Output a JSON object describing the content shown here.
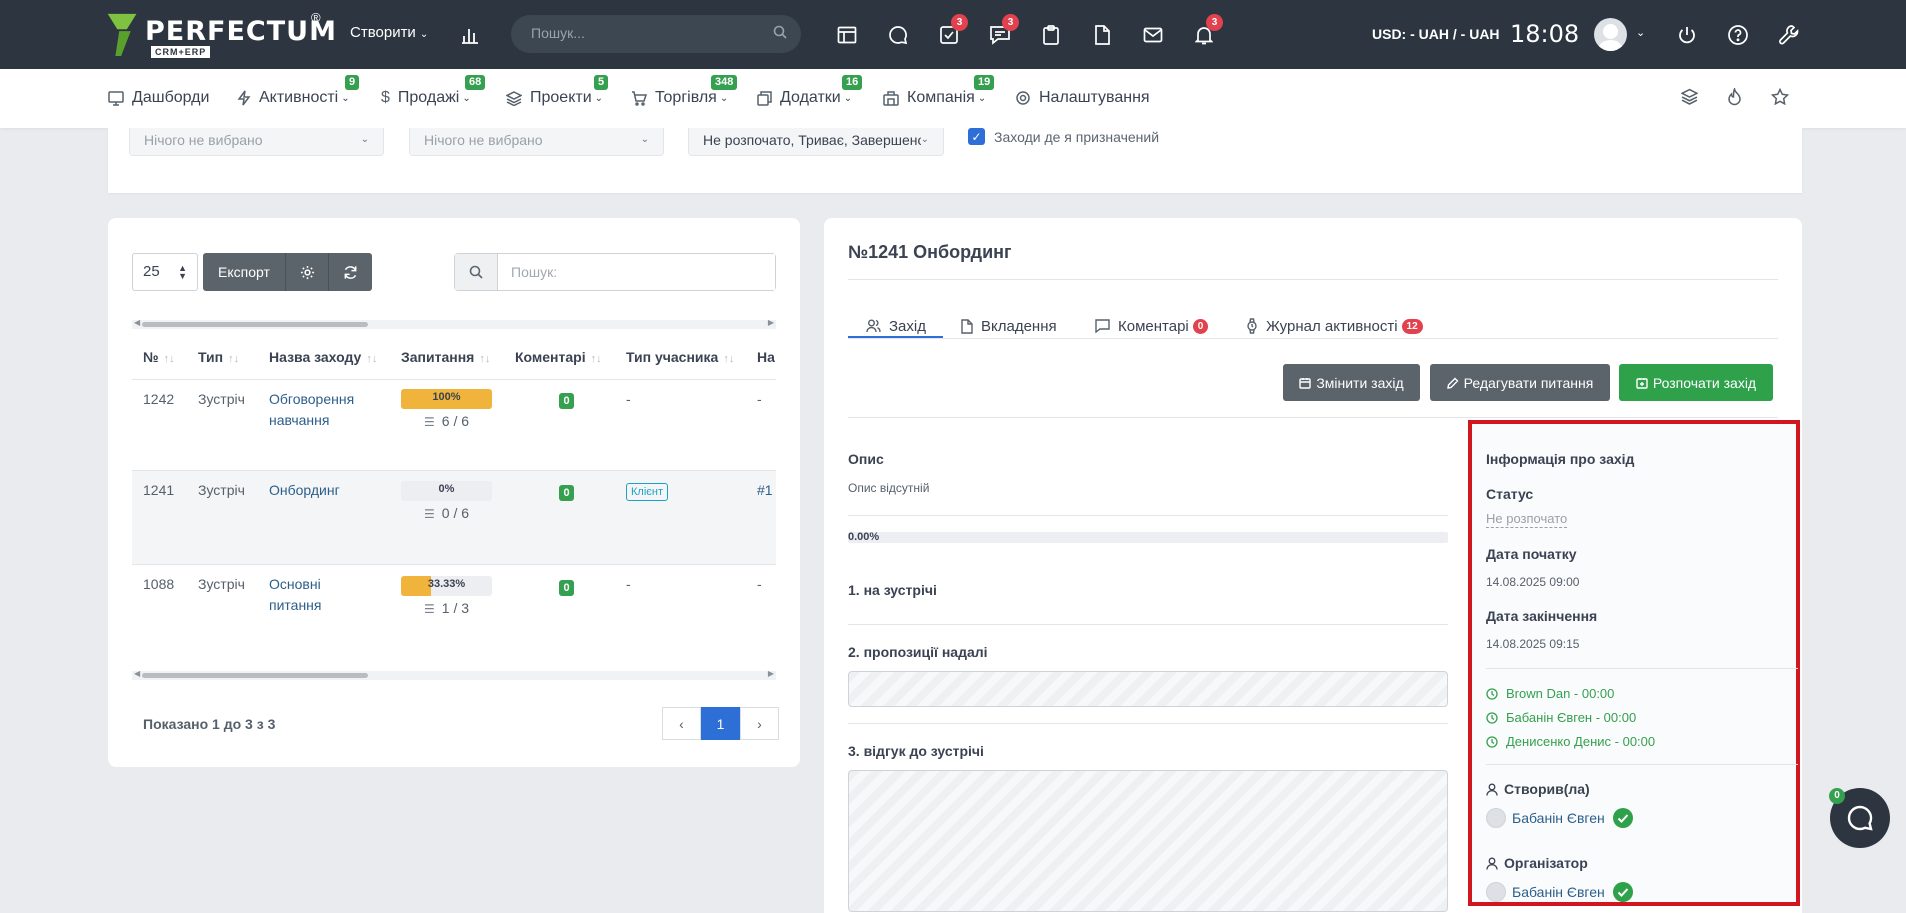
{
  "topbar": {
    "logo_text": "PERFECTUM",
    "logo_sub": "CRM+ERP",
    "logo_reg": "®",
    "create_label": "Створити",
    "search_placeholder": "Пошук...",
    "badges": {
      "tasks": "3",
      "chat": "3",
      "notifications": "3"
    },
    "currency": "USD: - UAH / - UAH",
    "time": "18:08"
  },
  "nav": {
    "items": [
      {
        "label": "Дашборди",
        "badge": ""
      },
      {
        "label": "Активності",
        "badge": "9"
      },
      {
        "label": "Продажі",
        "badge": "68"
      },
      {
        "label": "Проекти",
        "badge": "5"
      },
      {
        "label": "Торгівля",
        "badge": "348"
      },
      {
        "label": "Додатки",
        "badge": "16"
      },
      {
        "label": "Компанія",
        "badge": "19"
      },
      {
        "label": "Налаштування",
        "badge": ""
      }
    ]
  },
  "filters": {
    "select1": "Нічого не вибрано",
    "select2": "Нічого не вибрано",
    "select3": "Не розпочато, Триває, Завершено",
    "checkbox_label": "Заходи де я призначений"
  },
  "table": {
    "page_length": "25",
    "export_label": "Експорт",
    "search_placeholder": "Пошук:",
    "headers": [
      "№",
      "Тип",
      "Назва заходу",
      "Запитання",
      "Коментарі",
      "Тип учасника",
      "На"
    ],
    "rows": [
      {
        "id": "1242",
        "type": "Зустріч",
        "name1": "Обговорення",
        "name2": "навчання",
        "progress_label": "100%",
        "progress": 100,
        "count": "6 / 6",
        "comments": "0",
        "participant": "-",
        "extra": "-"
      },
      {
        "id": "1241",
        "type": "Зустріч",
        "name1": "Онбординг",
        "name2": "",
        "progress_label": "0%",
        "progress": 0,
        "count": "0 / 6",
        "comments": "0",
        "participant": "Клієнт",
        "extra": "#1"
      },
      {
        "id": "1088",
        "type": "Зустріч",
        "name1": "Основні",
        "name2": "питання",
        "progress_label": "33.33%",
        "progress": 33.33,
        "count": "1 / 3",
        "comments": "0",
        "participant": "-",
        "extra": "-"
      }
    ],
    "shown": "Показано 1 до 3 з 3",
    "current_page": "1"
  },
  "detail": {
    "title": "№1241 Онбординг",
    "tabs": [
      {
        "label": "Захід",
        "badge": ""
      },
      {
        "label": "Вкладення",
        "badge": ""
      },
      {
        "label": "Коментарі",
        "badge": "0"
      },
      {
        "label": "Журнал активності",
        "badge": "12"
      }
    ],
    "buttons": {
      "change": "Змінити захід",
      "edit_questions": "Редагувати питання",
      "start": "Розпочати захід"
    },
    "description_title": "Опис",
    "description_text": "Опис відсутній",
    "progress_label": "0.00%",
    "questions": [
      "1. на зустрічі",
      "2. пропозиції надалі",
      "3. відгук до зустрічі"
    ]
  },
  "info": {
    "title": "Інформація про захід",
    "status_title": "Статус",
    "status_value": "Не розпочато",
    "start_title": "Дата початку",
    "start_value": "14.08.2025 09:00",
    "end_title": "Дата закінчення",
    "end_value": "14.08.2025 09:15",
    "participants": [
      "Brown Dan - 00:00",
      "Бабанін Євген - 00:00",
      "Денисенко Денис - 00:00"
    ],
    "created_title": "Створив(ла)",
    "created_by": "Бабанін Євген",
    "organizer_title": "Організатор",
    "organizer": "Бабанін Євген"
  },
  "chat": {
    "badge": "0"
  },
  "colors": {
    "topbar": "#2d3640",
    "accent": "#2d6fd6",
    "success": "#35a04f",
    "danger": "#e2424e",
    "highlight": "#d0161e"
  }
}
